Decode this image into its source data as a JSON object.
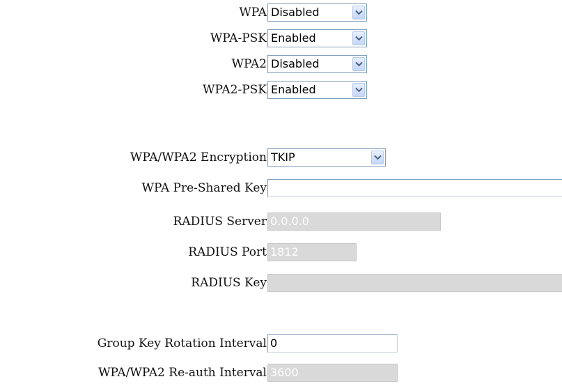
{
  "security": {
    "wpa": {
      "label": "WPA",
      "value": "Disabled"
    },
    "wpa_psk": {
      "label": "WPA-PSK",
      "value": "Enabled"
    },
    "wpa2": {
      "label": "WPA2",
      "value": "Disabled"
    },
    "wpa2_psk": {
      "label": "WPA2-PSK",
      "value": "Enabled"
    }
  },
  "encryption": {
    "label": "WPA/WPA2 Encryption",
    "value": "TKIP"
  },
  "psk": {
    "label": "WPA Pre-Shared Key",
    "value": ""
  },
  "radius": {
    "server_label": "RADIUS Server",
    "server_value": "0.0.0.0",
    "port_label": "RADIUS Port",
    "port_value": "1812",
    "key_label": "RADIUS Key",
    "key_value": ""
  },
  "intervals": {
    "group_key_label": "Group Key Rotation Interval",
    "group_key_value": "0",
    "reauth_label": "WPA/WPA2 Re-auth Interval",
    "reauth_value": "3600"
  },
  "colors": {
    "border": "#7f9db9",
    "disabled_bg": "#d9d9d9",
    "dropdown_button": "#c4d6f7"
  },
  "icons": {
    "dropdown": "chevron-down-icon"
  }
}
